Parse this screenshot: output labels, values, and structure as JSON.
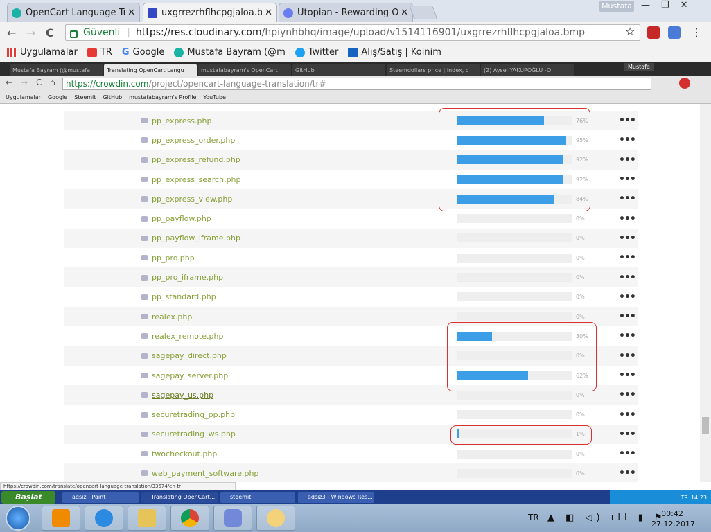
{
  "outer_browser": {
    "tabs": [
      {
        "title": "OpenCart Language Tran",
        "active": false
      },
      {
        "title": "uxgrrezrhflhcpgjaloa.bm",
        "active": true
      },
      {
        "title": "Utopian - Rewarding Op",
        "active": false
      }
    ],
    "close_glyph": "✕",
    "user": "Mustafa",
    "win_buttons": [
      "—",
      "❐",
      "✕"
    ],
    "nav": {
      "back": "←",
      "forward": "→",
      "reload": "C"
    },
    "secure_label": "Güvenli",
    "url_host": "https://res.cloudinary.com",
    "url_path": "/hpiynhbhq/image/upload/v1514116901/uxgrrezrhflhcpgjaloa.bmp",
    "star": "☆",
    "bookmarks": [
      "Uygulamalar",
      "TR",
      "Google",
      "Mustafa Bayram (@m",
      "Twitter",
      "Alış/Satış | Koinim"
    ]
  },
  "inner_browser": {
    "tabs": [
      "Mustafa Bayram (@mustafa",
      "Translating OpenCart Langu",
      "mustafabayram's OpenCart",
      "GitHub",
      "Steemdollars price | index, c",
      "(2) Aysel YAKUPOĞLU -O"
    ],
    "user": "Mustafa",
    "url_host": "https://crowdin.com",
    "url_path": "/project/opencart-language-translation/tr#",
    "bookmarks": [
      "Uygulamalar",
      "Google",
      "Steemit",
      "GitHub",
      "mustafabayram's Profile",
      "YouTube"
    ]
  },
  "files": [
    {
      "name": "pp_express.php",
      "progress": 76,
      "label": "76%"
    },
    {
      "name": "pp_express_order.php",
      "progress": 95,
      "label": "95%"
    },
    {
      "name": "pp_express_refund.php",
      "progress": 92,
      "label": "92%"
    },
    {
      "name": "pp_express_search.php",
      "progress": 92,
      "label": "92%"
    },
    {
      "name": "pp_express_view.php",
      "progress": 84,
      "label": "84%"
    },
    {
      "name": "pp_payflow.php",
      "progress": 0,
      "label": "0%"
    },
    {
      "name": "pp_payflow_iframe.php",
      "progress": 0,
      "label": "0%"
    },
    {
      "name": "pp_pro.php",
      "progress": 0,
      "label": "0%"
    },
    {
      "name": "pp_pro_iframe.php",
      "progress": 0,
      "label": "0%"
    },
    {
      "name": "pp_standard.php",
      "progress": 0,
      "label": "0%"
    },
    {
      "name": "realex.php",
      "progress": 0,
      "label": "0%"
    },
    {
      "name": "realex_remote.php",
      "progress": 30,
      "label": "30%"
    },
    {
      "name": "sagepay_direct.php",
      "progress": 0,
      "label": "0%"
    },
    {
      "name": "sagepay_server.php",
      "progress": 62,
      "label": "62%"
    },
    {
      "name": "sagepay_us.php",
      "progress": 0,
      "label": "0%",
      "hovered": true
    },
    {
      "name": "securetrading_pp.php",
      "progress": 0,
      "label": "0%"
    },
    {
      "name": "securetrading_ws.php",
      "progress": 1,
      "label": "1%"
    },
    {
      "name": "twocheckout.php",
      "progress": 0,
      "label": "0%"
    },
    {
      "name": "web_payment_software.php",
      "progress": 0,
      "label": "0%"
    }
  ],
  "more_glyph": "•••",
  "status_url": "https://crowdin.com/translate/opencart-language-translation/33574/en-tr",
  "inner_taskbar": {
    "start": "Başlat",
    "buttons": [
      "adsız - Paint",
      "Translating OpenCart...",
      "steemit",
      "adsız3 - Windows Res..."
    ],
    "lang": "TR",
    "time": "14:23"
  },
  "taskbar": {
    "lang": "TR",
    "tray_icons": "▲ ◧ ◁) ıll ▮ ⚑",
    "time": "00:42",
    "date": "27.12.2017"
  },
  "colors": {
    "accent": "#3d9ee8",
    "file_link": "#8aa03a",
    "highlight": "#d9312f"
  }
}
